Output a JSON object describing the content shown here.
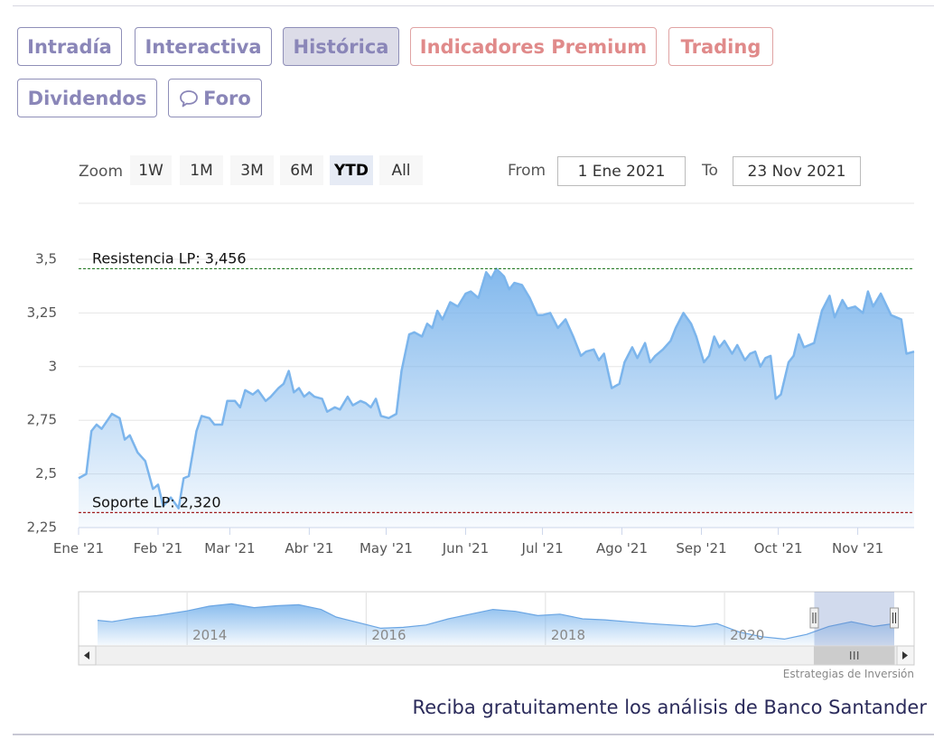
{
  "tabs": {
    "intradia": "Intradía",
    "interactiva": "Interactiva",
    "historica": "Histórica",
    "indicadores": "Indicadores Premium",
    "trading": "Trading",
    "dividendos": "Dividendos",
    "foro": "Foro"
  },
  "range_selector": {
    "zoom_label": "Zoom",
    "buttons": [
      "1W",
      "1M",
      "3M",
      "6M",
      "YTD",
      "All"
    ],
    "selected": "YTD",
    "from_label": "From",
    "from_value": "1 Ene 2021",
    "to_label": "To",
    "to_value": "23 Nov 2021"
  },
  "chart_data": {
    "type": "area",
    "title": "",
    "xlabel": "",
    "ylabel": "",
    "x_ticks": [
      "Ene '21",
      "Feb '21",
      "Mar '21",
      "Abr '21",
      "May '21",
      "Jun '21",
      "Jul '21",
      "Ago '21",
      "Sep '21",
      "Oct '21",
      "Nov '21"
    ],
    "y_ticks": [
      "2,25",
      "2,5",
      "2,75",
      "3",
      "3,25",
      "3,5"
    ],
    "y_tick_values": [
      2.25,
      2.5,
      2.75,
      3.0,
      3.25,
      3.5
    ],
    "ylim": [
      2.25,
      3.5
    ],
    "xlim": [
      "2021-01-01",
      "2021-11-23"
    ],
    "grid": "horizontal",
    "series": [
      {
        "color": "#7cb5ec",
        "points": [
          [
            "2021-01-01",
            2.48
          ],
          [
            "2021-01-04",
            2.5
          ],
          [
            "2021-01-06",
            2.7
          ],
          [
            "2021-01-08",
            2.73
          ],
          [
            "2021-01-10",
            2.71
          ],
          [
            "2021-01-14",
            2.78
          ],
          [
            "2021-01-17",
            2.76
          ],
          [
            "2021-01-19",
            2.66
          ],
          [
            "2021-01-21",
            2.68
          ],
          [
            "2021-01-24",
            2.6
          ],
          [
            "2021-01-27",
            2.56
          ],
          [
            "2021-01-30",
            2.43
          ],
          [
            "2021-02-01",
            2.45
          ],
          [
            "2021-02-03",
            2.35
          ],
          [
            "2021-02-06",
            2.39
          ],
          [
            "2021-02-09",
            2.34
          ],
          [
            "2021-02-11",
            2.48
          ],
          [
            "2021-02-13",
            2.49
          ],
          [
            "2021-02-16",
            2.7
          ],
          [
            "2021-02-18",
            2.77
          ],
          [
            "2021-02-21",
            2.76
          ],
          [
            "2021-02-23",
            2.73
          ],
          [
            "2021-02-26",
            2.73
          ],
          [
            "2021-02-28",
            2.84
          ],
          [
            "2021-03-03",
            2.84
          ],
          [
            "2021-03-05",
            2.81
          ],
          [
            "2021-03-07",
            2.89
          ],
          [
            "2021-03-10",
            2.87
          ],
          [
            "2021-03-12",
            2.89
          ],
          [
            "2021-03-15",
            2.84
          ],
          [
            "2021-03-17",
            2.86
          ],
          [
            "2021-03-20",
            2.9
          ],
          [
            "2021-03-22",
            2.92
          ],
          [
            "2021-03-24",
            2.98
          ],
          [
            "2021-03-26",
            2.88
          ],
          [
            "2021-03-28",
            2.9
          ],
          [
            "2021-03-30",
            2.86
          ],
          [
            "2021-04-01",
            2.88
          ],
          [
            "2021-04-03",
            2.86
          ],
          [
            "2021-04-06",
            2.85
          ],
          [
            "2021-04-08",
            2.79
          ],
          [
            "2021-04-11",
            2.81
          ],
          [
            "2021-04-13",
            2.8
          ],
          [
            "2021-04-16",
            2.86
          ],
          [
            "2021-04-18",
            2.82
          ],
          [
            "2021-04-21",
            2.84
          ],
          [
            "2021-04-23",
            2.83
          ],
          [
            "2021-04-25",
            2.81
          ],
          [
            "2021-04-27",
            2.85
          ],
          [
            "2021-04-29",
            2.77
          ],
          [
            "2021-05-02",
            2.76
          ],
          [
            "2021-05-05",
            2.78
          ],
          [
            "2021-05-07",
            2.98
          ],
          [
            "2021-05-10",
            3.15
          ],
          [
            "2021-05-12",
            3.16
          ],
          [
            "2021-05-15",
            3.14
          ],
          [
            "2021-05-17",
            3.2
          ],
          [
            "2021-05-19",
            3.18
          ],
          [
            "2021-05-21",
            3.26
          ],
          [
            "2021-05-23",
            3.22
          ],
          [
            "2021-05-26",
            3.3
          ],
          [
            "2021-05-29",
            3.28
          ],
          [
            "2021-06-01",
            3.34
          ],
          [
            "2021-06-03",
            3.35
          ],
          [
            "2021-06-06",
            3.32
          ],
          [
            "2021-06-09",
            3.44
          ],
          [
            "2021-06-11",
            3.41
          ],
          [
            "2021-06-13",
            3.456
          ],
          [
            "2021-06-16",
            3.42
          ],
          [
            "2021-06-18",
            3.36
          ],
          [
            "2021-06-20",
            3.39
          ],
          [
            "2021-06-23",
            3.38
          ],
          [
            "2021-06-26",
            3.32
          ],
          [
            "2021-06-29",
            3.24
          ],
          [
            "2021-07-01",
            3.24
          ],
          [
            "2021-07-04",
            3.25
          ],
          [
            "2021-07-07",
            3.18
          ],
          [
            "2021-07-10",
            3.22
          ],
          [
            "2021-07-13",
            3.14
          ],
          [
            "2021-07-16",
            3.05
          ],
          [
            "2021-07-18",
            3.07
          ],
          [
            "2021-07-21",
            3.08
          ],
          [
            "2021-07-23",
            3.03
          ],
          [
            "2021-07-25",
            3.06
          ],
          [
            "2021-07-28",
            2.9
          ],
          [
            "2021-07-31",
            2.92
          ],
          [
            "2021-08-02",
            3.02
          ],
          [
            "2021-08-05",
            3.09
          ],
          [
            "2021-08-07",
            3.04
          ],
          [
            "2021-08-10",
            3.11
          ],
          [
            "2021-08-12",
            3.02
          ],
          [
            "2021-08-14",
            3.05
          ],
          [
            "2021-08-17",
            3.08
          ],
          [
            "2021-08-20",
            3.12
          ],
          [
            "2021-08-22",
            3.18
          ],
          [
            "2021-08-25",
            3.25
          ],
          [
            "2021-08-28",
            3.2
          ],
          [
            "2021-08-30",
            3.14
          ],
          [
            "2021-09-02",
            3.02
          ],
          [
            "2021-09-04",
            3.05
          ],
          [
            "2021-09-06",
            3.14
          ],
          [
            "2021-09-08",
            3.09
          ],
          [
            "2021-09-10",
            3.12
          ],
          [
            "2021-09-13",
            3.06
          ],
          [
            "2021-09-15",
            3.1
          ],
          [
            "2021-09-18",
            3.03
          ],
          [
            "2021-09-20",
            3.06
          ],
          [
            "2021-09-22",
            3.07
          ],
          [
            "2021-09-24",
            3.0
          ],
          [
            "2021-09-26",
            3.04
          ],
          [
            "2021-09-28",
            3.05
          ],
          [
            "2021-09-30",
            2.85
          ],
          [
            "2021-10-02",
            2.87
          ],
          [
            "2021-10-05",
            3.02
          ],
          [
            "2021-10-07",
            3.05
          ],
          [
            "2021-10-09",
            3.15
          ],
          [
            "2021-10-11",
            3.09
          ],
          [
            "2021-10-13",
            3.1
          ],
          [
            "2021-10-15",
            3.11
          ],
          [
            "2021-10-18",
            3.26
          ],
          [
            "2021-10-21",
            3.33
          ],
          [
            "2021-10-23",
            3.23
          ],
          [
            "2021-10-26",
            3.31
          ],
          [
            "2021-10-28",
            3.27
          ],
          [
            "2021-10-31",
            3.28
          ],
          [
            "2021-11-03",
            3.25
          ],
          [
            "2021-11-05",
            3.35
          ],
          [
            "2021-11-07",
            3.28
          ],
          [
            "2021-11-10",
            3.34
          ],
          [
            "2021-11-12",
            3.29
          ],
          [
            "2021-11-14",
            3.24
          ],
          [
            "2021-11-16",
            3.23
          ],
          [
            "2021-11-18",
            3.22
          ],
          [
            "2021-11-20",
            3.06
          ],
          [
            "2021-11-23",
            3.07
          ]
        ]
      }
    ],
    "plot_lines": [
      {
        "label": "Resistencia LP: 3,456",
        "value": 3.456,
        "color": "#2a7d2a",
        "style": "dashed"
      },
      {
        "label": "Soporte LP: 2,320",
        "value": 2.32,
        "color": "#a11f1f",
        "style": "dashed"
      }
    ],
    "navigator": {
      "x_ticks": [
        "2014",
        "2016",
        "2018",
        "2020"
      ],
      "overview": [
        [
          "2013-01-01",
          0.45
        ],
        [
          "2013-03-01",
          0.42
        ],
        [
          "2013-06-01",
          0.5
        ],
        [
          "2013-09-01",
          0.55
        ],
        [
          "2014-01-01",
          0.65
        ],
        [
          "2014-04-01",
          0.75
        ],
        [
          "2014-07-01",
          0.8
        ],
        [
          "2014-10-01",
          0.72
        ],
        [
          "2015-01-01",
          0.76
        ],
        [
          "2015-04-01",
          0.78
        ],
        [
          "2015-07-01",
          0.68
        ],
        [
          "2015-09-01",
          0.52
        ],
        [
          "2015-12-01",
          0.4
        ],
        [
          "2016-03-01",
          0.28
        ],
        [
          "2016-06-01",
          0.3
        ],
        [
          "2016-09-01",
          0.35
        ],
        [
          "2016-12-01",
          0.48
        ],
        [
          "2017-03-01",
          0.58
        ],
        [
          "2017-06-01",
          0.68
        ],
        [
          "2017-09-01",
          0.64
        ],
        [
          "2017-12-01",
          0.55
        ],
        [
          "2018-03-01",
          0.58
        ],
        [
          "2018-06-01",
          0.48
        ],
        [
          "2018-09-01",
          0.46
        ],
        [
          "2018-12-01",
          0.42
        ],
        [
          "2019-03-01",
          0.38
        ],
        [
          "2019-06-01",
          0.35
        ],
        [
          "2019-09-01",
          0.32
        ],
        [
          "2019-12-01",
          0.38
        ],
        [
          "2020-03-01",
          0.2
        ],
        [
          "2020-06-01",
          0.1
        ],
        [
          "2020-09-01",
          0.05
        ],
        [
          "2020-12-01",
          0.15
        ],
        [
          "2021-03-01",
          0.32
        ],
        [
          "2021-06-01",
          0.42
        ],
        [
          "2021-09-01",
          0.32
        ],
        [
          "2021-11-23",
          0.38
        ]
      ],
      "xlim": [
        "2013-01-01",
        "2021-11-23"
      ],
      "selection": [
        "2021-01-01",
        "2021-11-23"
      ]
    }
  },
  "credit": "Estrategias de Inversión",
  "promo_text": "Reciba gratuitamente los análisis de Banco Santander"
}
